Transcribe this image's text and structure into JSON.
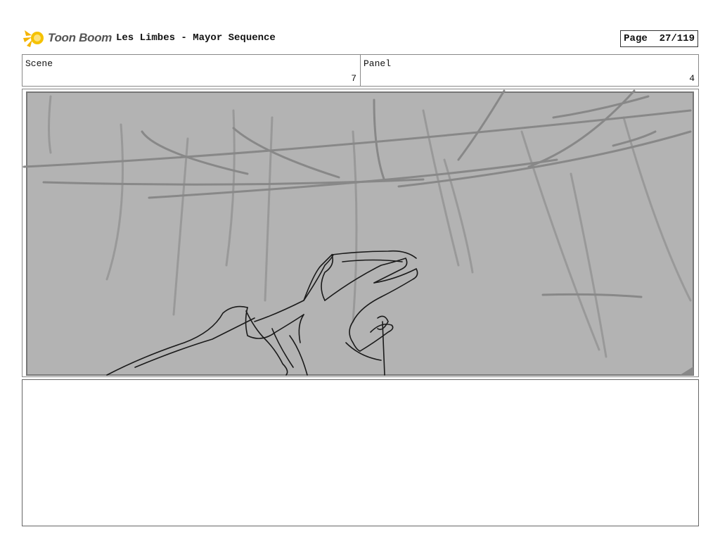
{
  "header": {
    "logo_text": "Toon Boom",
    "title": "Les Limbes - Mayor Sequence",
    "page_label": "Page",
    "page_number": "27/119"
  },
  "scene": {
    "label": "Scene",
    "value": "7"
  },
  "panel": {
    "label": "Panel",
    "value": "4"
  },
  "drawing": {
    "subject": "sketch-hand-reaching",
    "background_color": "#b3b3b3"
  },
  "notes": {
    "text": ""
  }
}
